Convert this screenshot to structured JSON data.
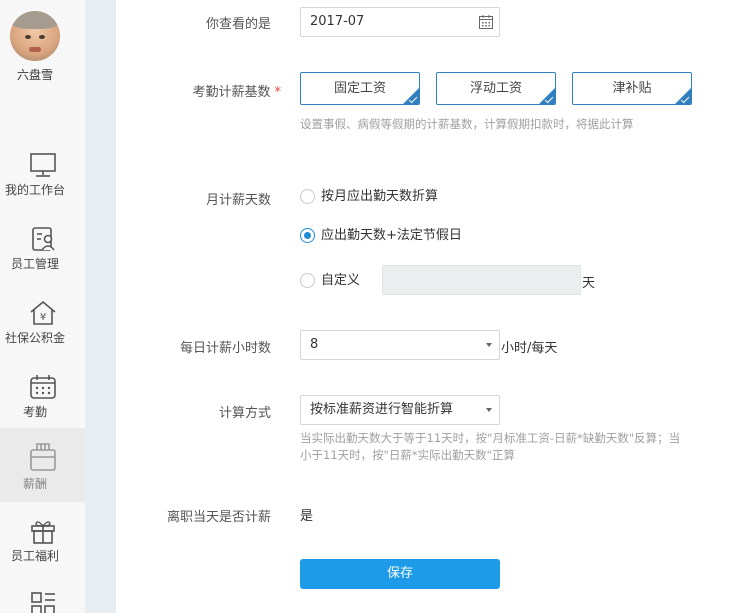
{
  "user": {
    "name": "六盘雪"
  },
  "nav": {
    "items": [
      {
        "label": "我的工作台",
        "icon": "monitor-icon"
      },
      {
        "label": "员工管理",
        "icon": "employee-icon"
      },
      {
        "label": "社保公积金",
        "icon": "social-security-house-icon"
      },
      {
        "label": "考勤",
        "icon": "calendar-icon"
      },
      {
        "label": "薪酬",
        "icon": "salary-icon",
        "active": true
      },
      {
        "label": "员工福利",
        "icon": "gift-icon"
      },
      {
        "label": "",
        "icon": "grid-icon"
      }
    ]
  },
  "form": {
    "viewing": {
      "label": "你查看的是",
      "value": "2017-07"
    },
    "base": {
      "label": "考勤计薪基数",
      "required_mark": "*",
      "options": [
        "固定工资",
        "浮动工资",
        "津补贴"
      ],
      "hint": "设置事假、病假等假期的计薪基数，计算假期扣款时，将据此计算"
    },
    "monthly_days": {
      "label": "月计薪天数",
      "options": [
        "按月应出勤天数折算",
        "应出勤天数+法定节假日",
        "自定义"
      ],
      "selected_index": 1,
      "custom_value": "",
      "custom_unit": "天"
    },
    "daily_hours": {
      "label": "每日计薪小时数",
      "value": "8",
      "unit": "小时/每天"
    },
    "calc_method": {
      "label": "计算方式",
      "value": "按标准薪资进行智能折算",
      "hint_line1": "当实际出勤天数大于等于11天时，按\"月标准工资-日薪*缺勤天数\"反算；当",
      "hint_line2": "小于11天时，按\"日薪*实际出勤天数\"正算"
    },
    "leave_day": {
      "label": "离职当天是否计薪",
      "value": "是"
    },
    "save_label": "保存"
  },
  "colors": {
    "accent": "#1d9be8",
    "tag_border": "#2f7fc1",
    "sidebar_bg": "#f7f7f7",
    "gutter_bg": "#e8edf1"
  }
}
